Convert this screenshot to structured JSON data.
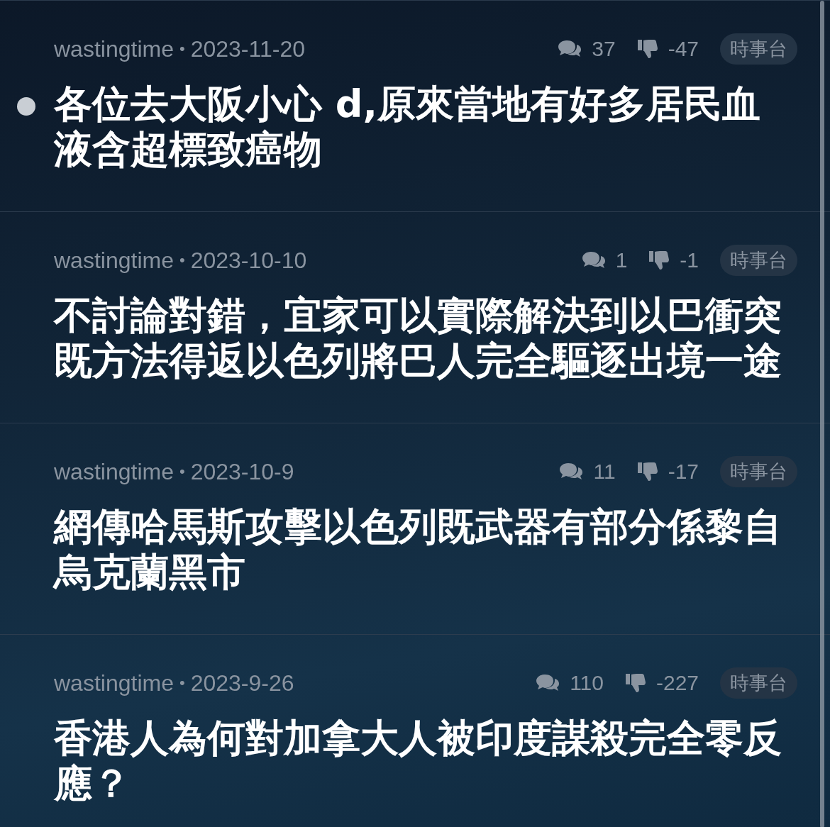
{
  "posts": [
    {
      "author": "wastingtime",
      "separator": "•",
      "date": "2023-11-20",
      "comments": "37",
      "score": "-47",
      "tag": "時事台",
      "title": "各位去大阪小心 d,原來當地有好多居民血液含超標致癌物",
      "unread": true
    },
    {
      "author": "wastingtime",
      "separator": "•",
      "date": "2023-10-10",
      "comments": "1",
      "score": "-1",
      "tag": "時事台",
      "title": "不討論對錯，宜家可以實際解決到以巴衝突既方法得返以色列將巴人完全驅逐出境一途",
      "unread": false
    },
    {
      "author": "wastingtime",
      "separator": "•",
      "date": "2023-10-9",
      "comments": "11",
      "score": "-17",
      "tag": "時事台",
      "title": "網傳哈馬斯攻擊以色列既武器有部分係黎自烏克蘭黑市",
      "unread": false
    },
    {
      "author": "wastingtime",
      "separator": "•",
      "date": "2023-9-26",
      "comments": "110",
      "score": "-227",
      "tag": "時事台",
      "title": "香港人為何對加拿大人被印度謀殺完全零反應？",
      "unread": false
    }
  ]
}
